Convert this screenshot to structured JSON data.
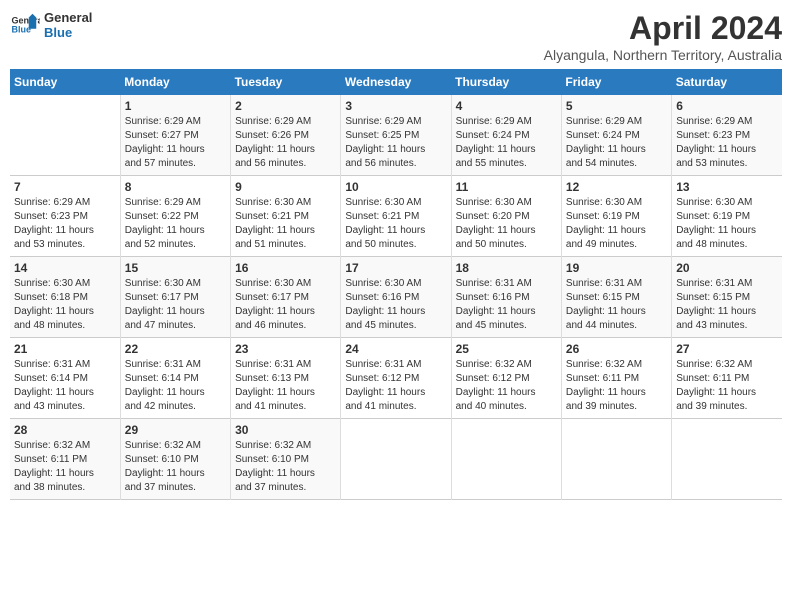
{
  "header": {
    "logo_line1": "General",
    "logo_line2": "Blue",
    "month_year": "April 2024",
    "location": "Alyangula, Northern Territory, Australia"
  },
  "weekdays": [
    "Sunday",
    "Monday",
    "Tuesday",
    "Wednesday",
    "Thursday",
    "Friday",
    "Saturday"
  ],
  "weeks": [
    [
      {
        "num": "",
        "info": ""
      },
      {
        "num": "1",
        "info": "Sunrise: 6:29 AM\nSunset: 6:27 PM\nDaylight: 11 hours\nand 57 minutes."
      },
      {
        "num": "2",
        "info": "Sunrise: 6:29 AM\nSunset: 6:26 PM\nDaylight: 11 hours\nand 56 minutes."
      },
      {
        "num": "3",
        "info": "Sunrise: 6:29 AM\nSunset: 6:25 PM\nDaylight: 11 hours\nand 56 minutes."
      },
      {
        "num": "4",
        "info": "Sunrise: 6:29 AM\nSunset: 6:24 PM\nDaylight: 11 hours\nand 55 minutes."
      },
      {
        "num": "5",
        "info": "Sunrise: 6:29 AM\nSunset: 6:24 PM\nDaylight: 11 hours\nand 54 minutes."
      },
      {
        "num": "6",
        "info": "Sunrise: 6:29 AM\nSunset: 6:23 PM\nDaylight: 11 hours\nand 53 minutes."
      }
    ],
    [
      {
        "num": "7",
        "info": "Sunrise: 6:29 AM\nSunset: 6:23 PM\nDaylight: 11 hours\nand 53 minutes."
      },
      {
        "num": "8",
        "info": "Sunrise: 6:29 AM\nSunset: 6:22 PM\nDaylight: 11 hours\nand 52 minutes."
      },
      {
        "num": "9",
        "info": "Sunrise: 6:30 AM\nSunset: 6:21 PM\nDaylight: 11 hours\nand 51 minutes."
      },
      {
        "num": "10",
        "info": "Sunrise: 6:30 AM\nSunset: 6:21 PM\nDaylight: 11 hours\nand 50 minutes."
      },
      {
        "num": "11",
        "info": "Sunrise: 6:30 AM\nSunset: 6:20 PM\nDaylight: 11 hours\nand 50 minutes."
      },
      {
        "num": "12",
        "info": "Sunrise: 6:30 AM\nSunset: 6:19 PM\nDaylight: 11 hours\nand 49 minutes."
      },
      {
        "num": "13",
        "info": "Sunrise: 6:30 AM\nSunset: 6:19 PM\nDaylight: 11 hours\nand 48 minutes."
      }
    ],
    [
      {
        "num": "14",
        "info": "Sunrise: 6:30 AM\nSunset: 6:18 PM\nDaylight: 11 hours\nand 48 minutes."
      },
      {
        "num": "15",
        "info": "Sunrise: 6:30 AM\nSunset: 6:17 PM\nDaylight: 11 hours\nand 47 minutes."
      },
      {
        "num": "16",
        "info": "Sunrise: 6:30 AM\nSunset: 6:17 PM\nDaylight: 11 hours\nand 46 minutes."
      },
      {
        "num": "17",
        "info": "Sunrise: 6:30 AM\nSunset: 6:16 PM\nDaylight: 11 hours\nand 45 minutes."
      },
      {
        "num": "18",
        "info": "Sunrise: 6:31 AM\nSunset: 6:16 PM\nDaylight: 11 hours\nand 45 minutes."
      },
      {
        "num": "19",
        "info": "Sunrise: 6:31 AM\nSunset: 6:15 PM\nDaylight: 11 hours\nand 44 minutes."
      },
      {
        "num": "20",
        "info": "Sunrise: 6:31 AM\nSunset: 6:15 PM\nDaylight: 11 hours\nand 43 minutes."
      }
    ],
    [
      {
        "num": "21",
        "info": "Sunrise: 6:31 AM\nSunset: 6:14 PM\nDaylight: 11 hours\nand 43 minutes."
      },
      {
        "num": "22",
        "info": "Sunrise: 6:31 AM\nSunset: 6:14 PM\nDaylight: 11 hours\nand 42 minutes."
      },
      {
        "num": "23",
        "info": "Sunrise: 6:31 AM\nSunset: 6:13 PM\nDaylight: 11 hours\nand 41 minutes."
      },
      {
        "num": "24",
        "info": "Sunrise: 6:31 AM\nSunset: 6:12 PM\nDaylight: 11 hours\nand 41 minutes."
      },
      {
        "num": "25",
        "info": "Sunrise: 6:32 AM\nSunset: 6:12 PM\nDaylight: 11 hours\nand 40 minutes."
      },
      {
        "num": "26",
        "info": "Sunrise: 6:32 AM\nSunset: 6:11 PM\nDaylight: 11 hours\nand 39 minutes."
      },
      {
        "num": "27",
        "info": "Sunrise: 6:32 AM\nSunset: 6:11 PM\nDaylight: 11 hours\nand 39 minutes."
      }
    ],
    [
      {
        "num": "28",
        "info": "Sunrise: 6:32 AM\nSunset: 6:11 PM\nDaylight: 11 hours\nand 38 minutes."
      },
      {
        "num": "29",
        "info": "Sunrise: 6:32 AM\nSunset: 6:10 PM\nDaylight: 11 hours\nand 37 minutes."
      },
      {
        "num": "30",
        "info": "Sunrise: 6:32 AM\nSunset: 6:10 PM\nDaylight: 11 hours\nand 37 minutes."
      },
      {
        "num": "",
        "info": ""
      },
      {
        "num": "",
        "info": ""
      },
      {
        "num": "",
        "info": ""
      },
      {
        "num": "",
        "info": ""
      }
    ]
  ]
}
